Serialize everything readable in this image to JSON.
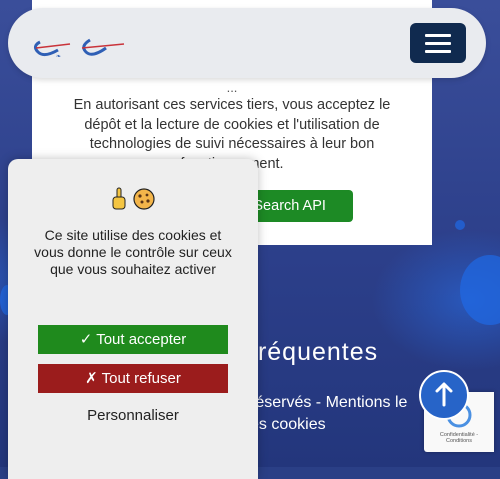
{
  "header": {
    "logo_alt": "logo",
    "menu_label": "menu"
  },
  "consent_box": {
    "ellipsis": "...",
    "text": "En autorisant ces services tiers, vous acceptez le dépôt et la lecture de cookies et l'utilisation de technologies de suivi nécessaires à leur bon fonctionnement.",
    "api_button_label": "ps Search API"
  },
  "page": {
    "faq_heading": "fréquentes",
    "footer_line_1": "réservés - Mentions le",
    "footer_line_2": "es cookies"
  },
  "cookie_banner": {
    "description": "Ce site utilise des cookies et vous donne le contrôle sur ceux que vous souhaitez activer",
    "accept_label": "✓ Tout accepter",
    "refuse_label": "✗ Tout refuser",
    "customize_label": "Personnaliser",
    "icons": [
      "pointing-hand-icon",
      "cookie-icon"
    ]
  },
  "recaptcha": {
    "text": "Confidentialité - Conditions"
  },
  "colors": {
    "accept": "#1f8a1d",
    "refuse": "#9b1c1c",
    "menu_button": "#102a4f",
    "scroll_top": "#2764c8"
  }
}
